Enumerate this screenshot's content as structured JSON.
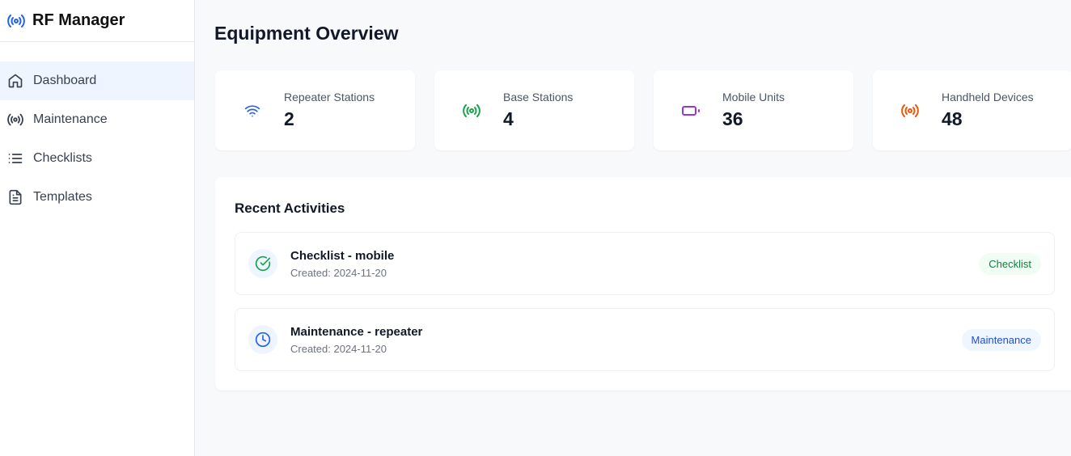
{
  "app": {
    "title": "RF Manager"
  },
  "sidebar": {
    "items": [
      {
        "label": "Dashboard"
      },
      {
        "label": "Maintenance"
      },
      {
        "label": "Checklists"
      },
      {
        "label": "Templates"
      }
    ]
  },
  "main": {
    "title": "Equipment Overview",
    "cards": [
      {
        "label": "Repeater Stations",
        "value": "2",
        "icon": "wifi-icon",
        "color": "#2563eb"
      },
      {
        "label": "Base Stations",
        "value": "4",
        "icon": "radio-icon",
        "color": "#16a34a"
      },
      {
        "label": "Mobile Units",
        "value": "36",
        "icon": "battery-icon",
        "color": "#9333ea"
      },
      {
        "label": "Handheld Devices",
        "value": "48",
        "icon": "radio-icon",
        "color": "#ea580c"
      }
    ],
    "recent": {
      "title": "Recent Activities",
      "items": [
        {
          "title": "Checklist - mobile",
          "date": "Created: 2024-11-20",
          "badge": "Checklist"
        },
        {
          "title": "Maintenance - repeater",
          "date": "Created: 2024-11-20",
          "badge": "Maintenance"
        }
      ]
    }
  }
}
